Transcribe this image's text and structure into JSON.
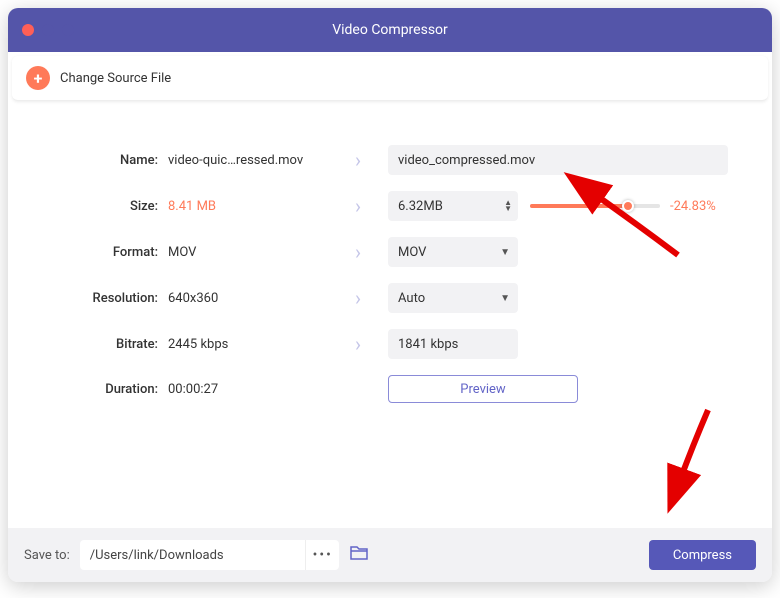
{
  "window": {
    "title": "Video Compressor"
  },
  "toolbar": {
    "change_source": "Change Source File"
  },
  "labels": {
    "name": "Name:",
    "size": "Size:",
    "format": "Format:",
    "resolution": "Resolution:",
    "bitrate": "Bitrate:",
    "duration": "Duration:"
  },
  "src": {
    "name": "video-quic…ressed.mov",
    "size": "8.41 MB",
    "format": "MOV",
    "resolution": "640x360",
    "bitrate": "2445 kbps",
    "duration": "00:00:27"
  },
  "out": {
    "name": "video_compressed.mov",
    "size": "6.32MB",
    "format": "MOV",
    "resolution": "Auto",
    "bitrate": "1841 kbps"
  },
  "size_pct": "-24.83%",
  "preview": "Preview",
  "footer": {
    "saveto": "Save to:",
    "path": "/Users/link/Downloads",
    "compress": "Compress"
  }
}
